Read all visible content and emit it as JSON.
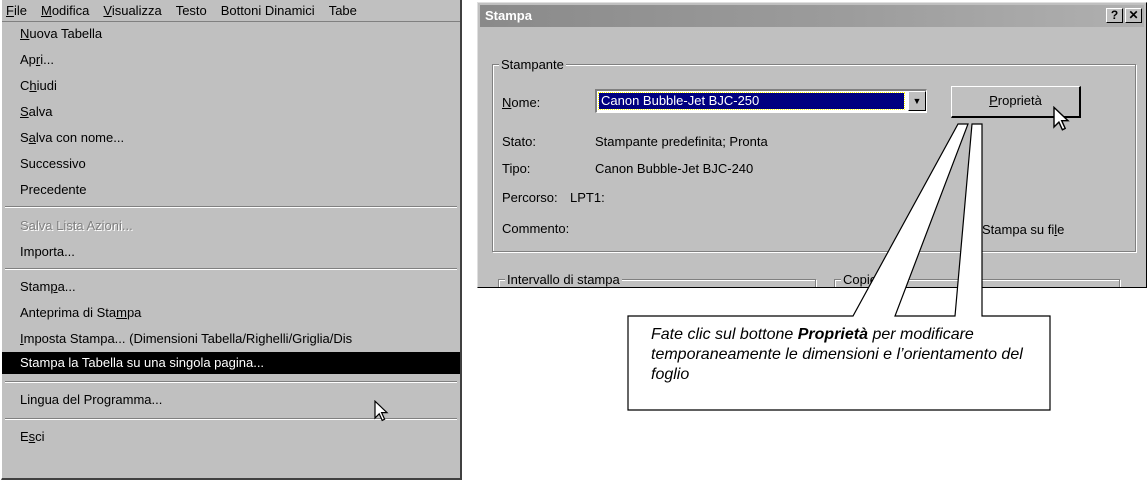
{
  "menubar": [
    {
      "label": "File",
      "u": "F",
      "rest": "ile"
    },
    {
      "label": "Modifica",
      "u": "M",
      "rest": "odifica"
    },
    {
      "label": "Visualizza",
      "u": "V",
      "rest": "isualizza"
    },
    {
      "label": "Testo",
      "u": "",
      "rest": "Testo"
    },
    {
      "label": "Bottoni Dinamici",
      "u": "",
      "rest": "Bottoni Dinamici"
    },
    {
      "label": "Tabe",
      "u": "",
      "rest": "Tabe"
    }
  ],
  "file_menu": {
    "items": [
      {
        "pre": "",
        "u": "N",
        "post": "uova Tabella"
      },
      {
        "pre": "Ap",
        "u": "r",
        "post": "i..."
      },
      {
        "pre": "C",
        "u": "h",
        "post": "iudi"
      },
      {
        "pre": "",
        "u": "S",
        "post": "alva"
      },
      {
        "pre": "S",
        "u": "a",
        "post": "lva con nome..."
      },
      {
        "pre": "Successivo",
        "u": "",
        "post": ""
      },
      {
        "pre": "Precedente",
        "u": "",
        "post": ""
      },
      {
        "pre": "Salva Lista Azioni...",
        "u": "",
        "post": ""
      },
      {
        "pre": "Importa...",
        "u": "",
        "post": ""
      },
      {
        "pre": "Stam",
        "u": "p",
        "post": "a..."
      },
      {
        "pre": "Anteprima di Sta",
        "u": "m",
        "post": "pa"
      },
      {
        "pre": "",
        "u": "I",
        "post": "mposta Stampa... (Dimensioni Tabella/Righelli/Griglia/Dis"
      },
      {
        "pre": "Stampa la Tabella su una singola pagina...",
        "u": "",
        "post": ""
      },
      {
        "pre": "Lingua del Programma...",
        "u": "",
        "post": ""
      },
      {
        "pre": "E",
        "u": "s",
        "post": "ci"
      }
    ]
  },
  "dialog": {
    "title": "Stampa",
    "help_label": "?",
    "close_label": "✕",
    "printer_group": "Stampante",
    "name_label_u": "N",
    "name_label_rest": "ome:",
    "printer_name": "Canon Bubble-Jet BJC-250",
    "combo_arrow": "▼",
    "properties_u": "P",
    "properties_rest": "roprietà",
    "status_label": "Stato:",
    "status_value": "Stampante predefinita; Pronta",
    "type_label": "Tipo:",
    "type_value": "Canon Bubble-Jet BJC-240",
    "path_label": "Percorso:",
    "path_value": "LPT1:",
    "comment_label": "Commento:",
    "print_to_file_pre": "Stampa su fi",
    "print_to_file_u": "l",
    "print_to_file_post": "e",
    "range_group": "Intervallo di stampa",
    "copies_group": "Copie"
  },
  "callout": {
    "pre": "Fate clic sul bottone ",
    "bold": "Proprietà",
    "post": " per modificare temporaneamente le dimensioni e l’orientamento del foglio"
  }
}
